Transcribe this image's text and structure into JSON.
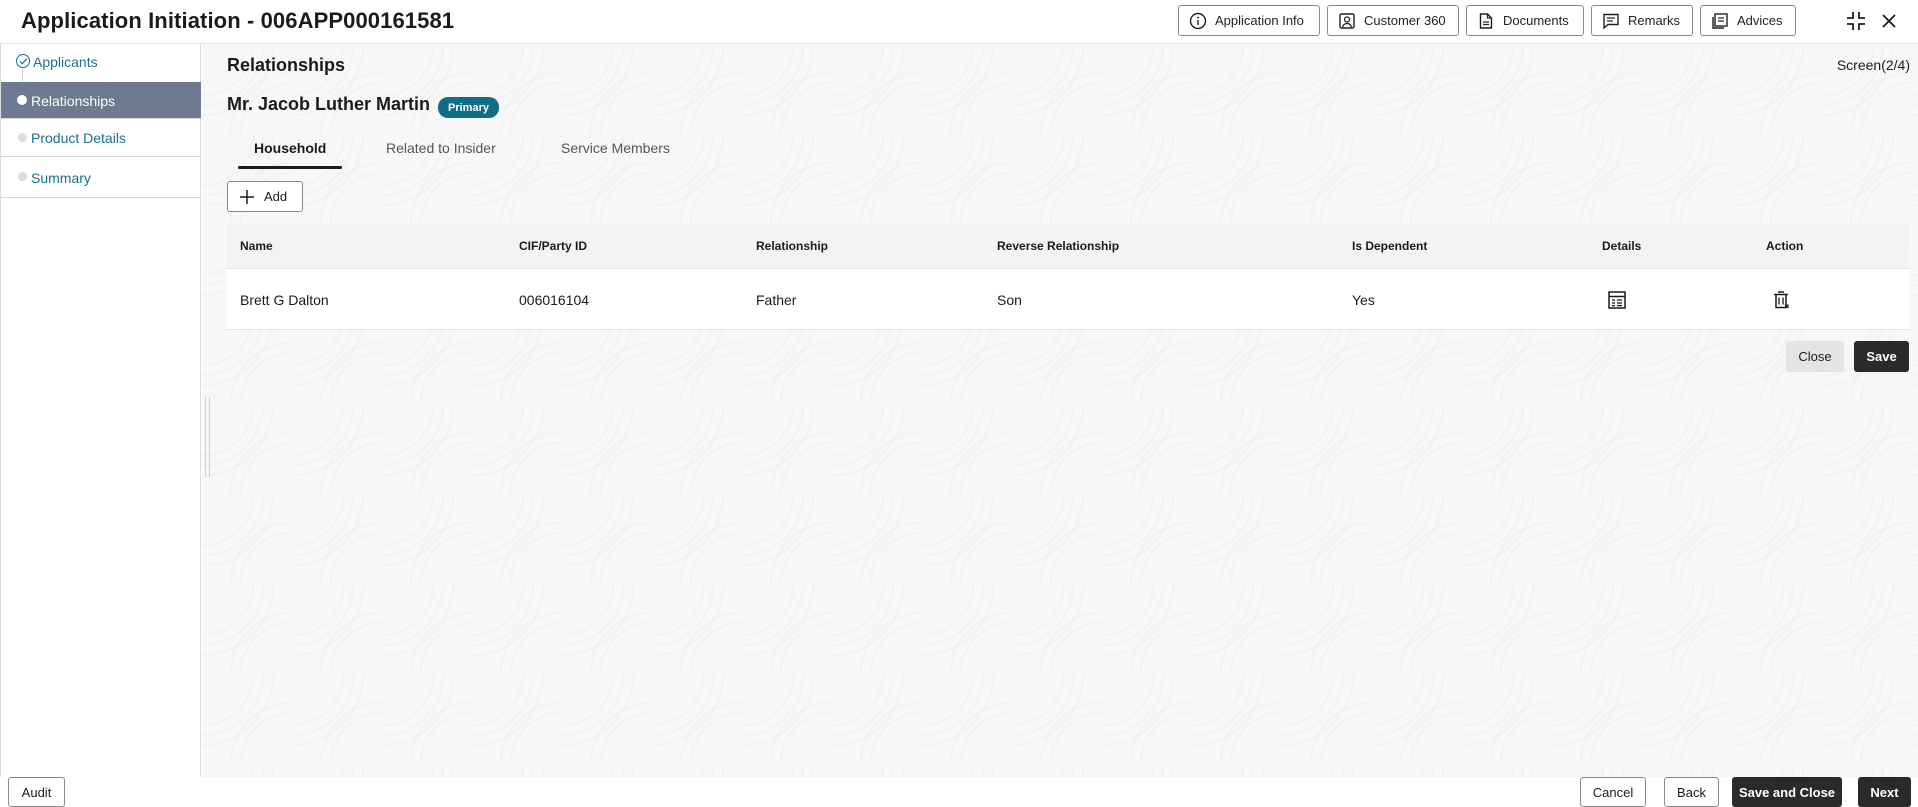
{
  "header": {
    "title": "Application Initiation - 006APP000161581",
    "buttons": [
      {
        "label": "Application Info",
        "icon": "info-icon"
      },
      {
        "label": "Customer 360",
        "icon": "user-icon"
      },
      {
        "label": "Documents",
        "icon": "document-icon"
      },
      {
        "label": "Remarks",
        "icon": "remarks-icon"
      },
      {
        "label": "Advices",
        "icon": "advices-icon"
      }
    ],
    "window_icons": [
      "minimize-icon",
      "close-icon"
    ]
  },
  "sidebar": {
    "steps": [
      {
        "label": "Applicants",
        "state": "completed"
      },
      {
        "label": "Relationships",
        "state": "active"
      },
      {
        "label": "Product Details",
        "state": "pending"
      },
      {
        "label": "Summary",
        "state": "pending"
      }
    ]
  },
  "main": {
    "section_title": "Relationships",
    "screen_counter": "Screen(2/4)",
    "applicant_name": "Mr. Jacob Luther Martin",
    "applicant_badge": "Primary",
    "tabs": [
      {
        "label": "Household",
        "active": true
      },
      {
        "label": "Related to Insider",
        "active": false
      },
      {
        "label": "Service Members",
        "active": false
      }
    ],
    "add_label": "Add",
    "table": {
      "columns": [
        "Name",
        "CIF/Party ID",
        "Relationship",
        "Reverse Relationship",
        "Is Dependent",
        "Details",
        "Action"
      ],
      "rows": [
        {
          "name": "Brett G Dalton",
          "cif": "006016104",
          "relationship": "Father",
          "reverse": "Son",
          "dependent": "Yes",
          "details_icon": "details-icon",
          "action_icon": "delete-icon"
        }
      ]
    },
    "close_label": "Close",
    "save_label": "Save"
  },
  "footer": {
    "audit_label": "Audit",
    "cancel_label": "Cancel",
    "back_label": "Back",
    "save_close_label": "Save and Close",
    "next_label": "Next"
  },
  "colors": {
    "accent": "#1b6f8e",
    "badge": "#0f6d86",
    "active_step": "#6d7a8f",
    "dark_button": "#2a2a2a"
  }
}
